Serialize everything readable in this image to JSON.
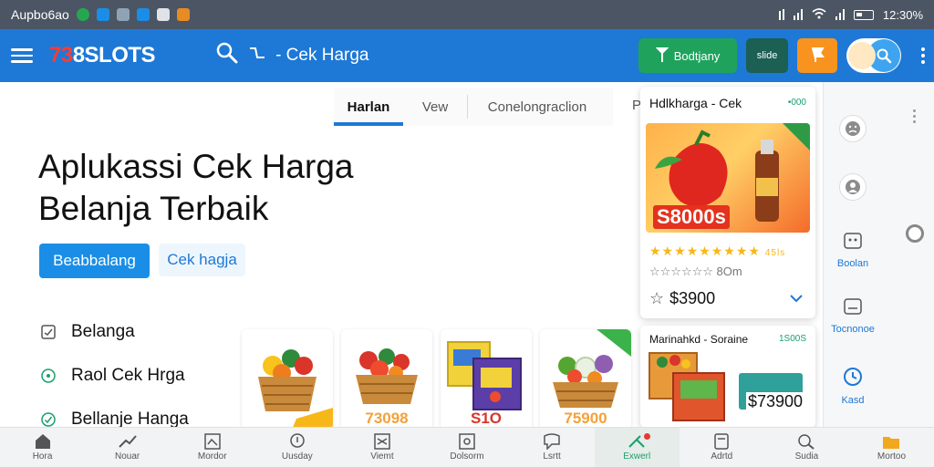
{
  "status_bar": {
    "carrier": "Aupbo6ao",
    "time": "12:30%"
  },
  "app_bar": {
    "logo_number": "73",
    "logo_text": "8SLOTS",
    "search_label": "- Cek Harga",
    "btn_green_label": "Bodtjany",
    "btn_darkgreen_label": "slide"
  },
  "tabs": {
    "items": [
      "Harlan",
      "Vew",
      "Conelongraclion"
    ],
    "more": "P"
  },
  "hero": {
    "title": "Aplukassi Cek Harga Belanja Terbaik",
    "primary_button": "Beabbalang",
    "secondary_button": "Cek hagja"
  },
  "menu": {
    "items": [
      "Belanga",
      "Raol Cek Hrga",
      "Bellanje Hanga"
    ]
  },
  "products": [
    {
      "price": "",
      "theme": "basket-fruit"
    },
    {
      "price": "73098",
      "theme": "basket-veg"
    },
    {
      "price": "S1O",
      "theme": "boxes"
    },
    {
      "price": "75900",
      "theme": "basket-mixed"
    }
  ],
  "side_card_1": {
    "title": "Hdlkharga - Cek",
    "tag": "•000",
    "promo": "S8000s",
    "stars_note": "45ls",
    "rating_text": "8Om",
    "price": "$3900"
  },
  "side_card_2": {
    "title": "Marinahkd - Soraine",
    "tag": "1S00S",
    "price": "$73900"
  },
  "right_rail": {
    "items": [
      "",
      "",
      "Boolan",
      "Tocnonoe",
      "Kasd"
    ]
  },
  "bottom_nav": {
    "items": [
      "Hora",
      "Nouar",
      "Mordor",
      "Uusday",
      "Viemt",
      "Dolsorm",
      "Lsrtt",
      "Exwerl",
      "Adrtd",
      "Sudia",
      "Mortoo"
    ],
    "active_index": 7
  },
  "colors": {
    "primary": "#1e78d6",
    "accent_green": "#1fa35c",
    "accent_orange": "#f7931e",
    "price_orange": "#f4a13a"
  }
}
